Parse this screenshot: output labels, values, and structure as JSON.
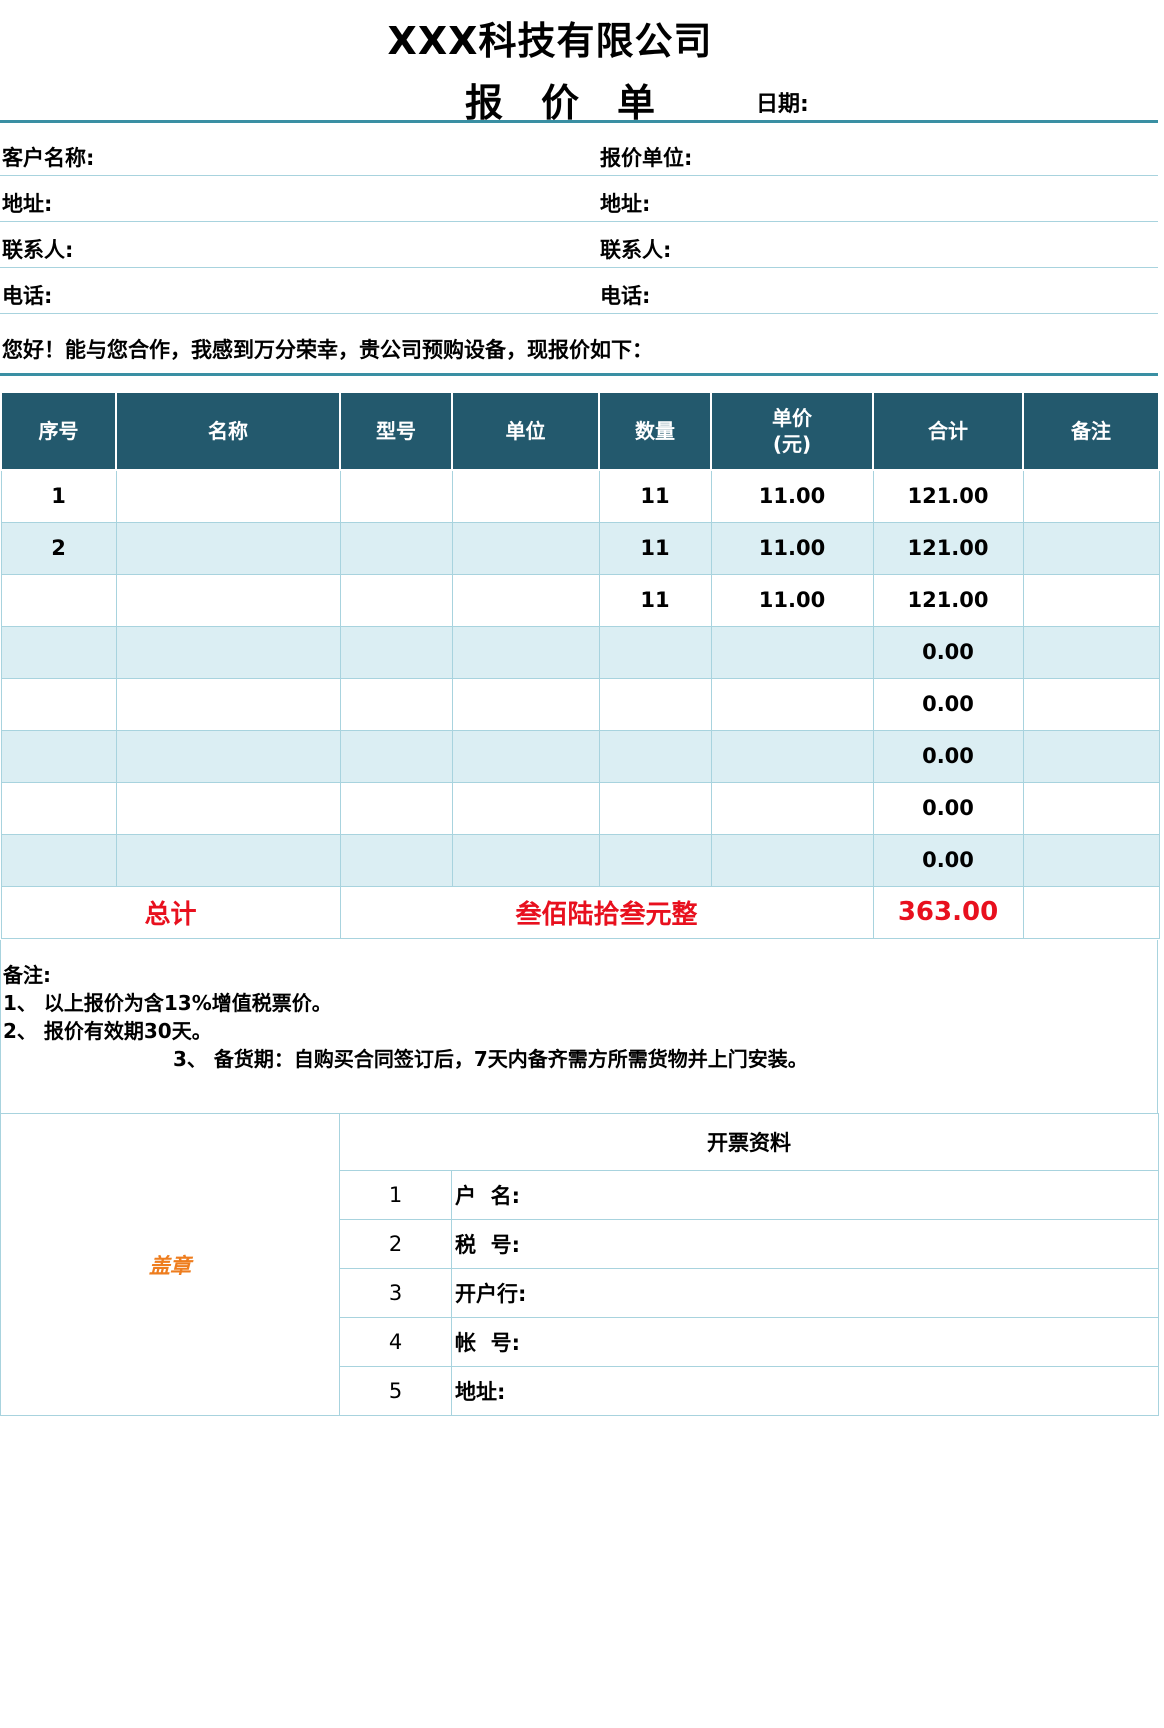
{
  "header": {
    "company": "XXX科技有限公司",
    "title": "报价单",
    "date_label": "日期:"
  },
  "info": {
    "rows": [
      {
        "left": "客户名称:",
        "right": "报价单位:"
      },
      {
        "left": "地址:",
        "right": "地址:"
      },
      {
        "left": "联系人:",
        "right": "联系人:"
      },
      {
        "left": "电话:",
        "right": "电话:"
      }
    ]
  },
  "greeting": "您好！能与您合作，我感到万分荣幸，贵公司预购设备，现报价如下：",
  "table": {
    "headers": [
      "序号",
      "名称",
      "型号",
      "单位",
      "数量",
      "单价\n(元)",
      "合计",
      "备注"
    ],
    "rows": [
      [
        "1",
        "",
        "",
        "",
        "11",
        "11.00",
        "121.00",
        ""
      ],
      [
        "2",
        "",
        "",
        "",
        "11",
        "11.00",
        "121.00",
        ""
      ],
      [
        "",
        "",
        "",
        "",
        "11",
        "11.00",
        "121.00",
        ""
      ],
      [
        "",
        "",
        "",
        "",
        "",
        "",
        "0.00",
        ""
      ],
      [
        "",
        "",
        "",
        "",
        "",
        "",
        "0.00",
        ""
      ],
      [
        "",
        "",
        "",
        "",
        "",
        "",
        "0.00",
        ""
      ],
      [
        "",
        "",
        "",
        "",
        "",
        "",
        "0.00",
        ""
      ],
      [
        "",
        "",
        "",
        "",
        "",
        "",
        "0.00",
        ""
      ]
    ],
    "total": {
      "label": "总计",
      "amount_words": "叁佰陆拾叁元整",
      "amount": "363.00"
    }
  },
  "notes": {
    "title": "备注:",
    "items": [
      "1、 以上报价为含13%增值税票价。",
      "2、 报价有效期30天。",
      "3、 备货期：自购买合同签订后，7天内备齐需方所需货物并上门安装。"
    ]
  },
  "invoice": {
    "stamp": "盖章",
    "title": "开票资料",
    "rows": [
      {
        "no": "1",
        "label": "户  名:"
      },
      {
        "no": "2",
        "label": "税  号:"
      },
      {
        "no": "3",
        "label": "开户行:"
      },
      {
        "no": "4",
        "label": "帐  号:"
      },
      {
        "no": "5",
        "label": "地址:"
      }
    ]
  }
}
